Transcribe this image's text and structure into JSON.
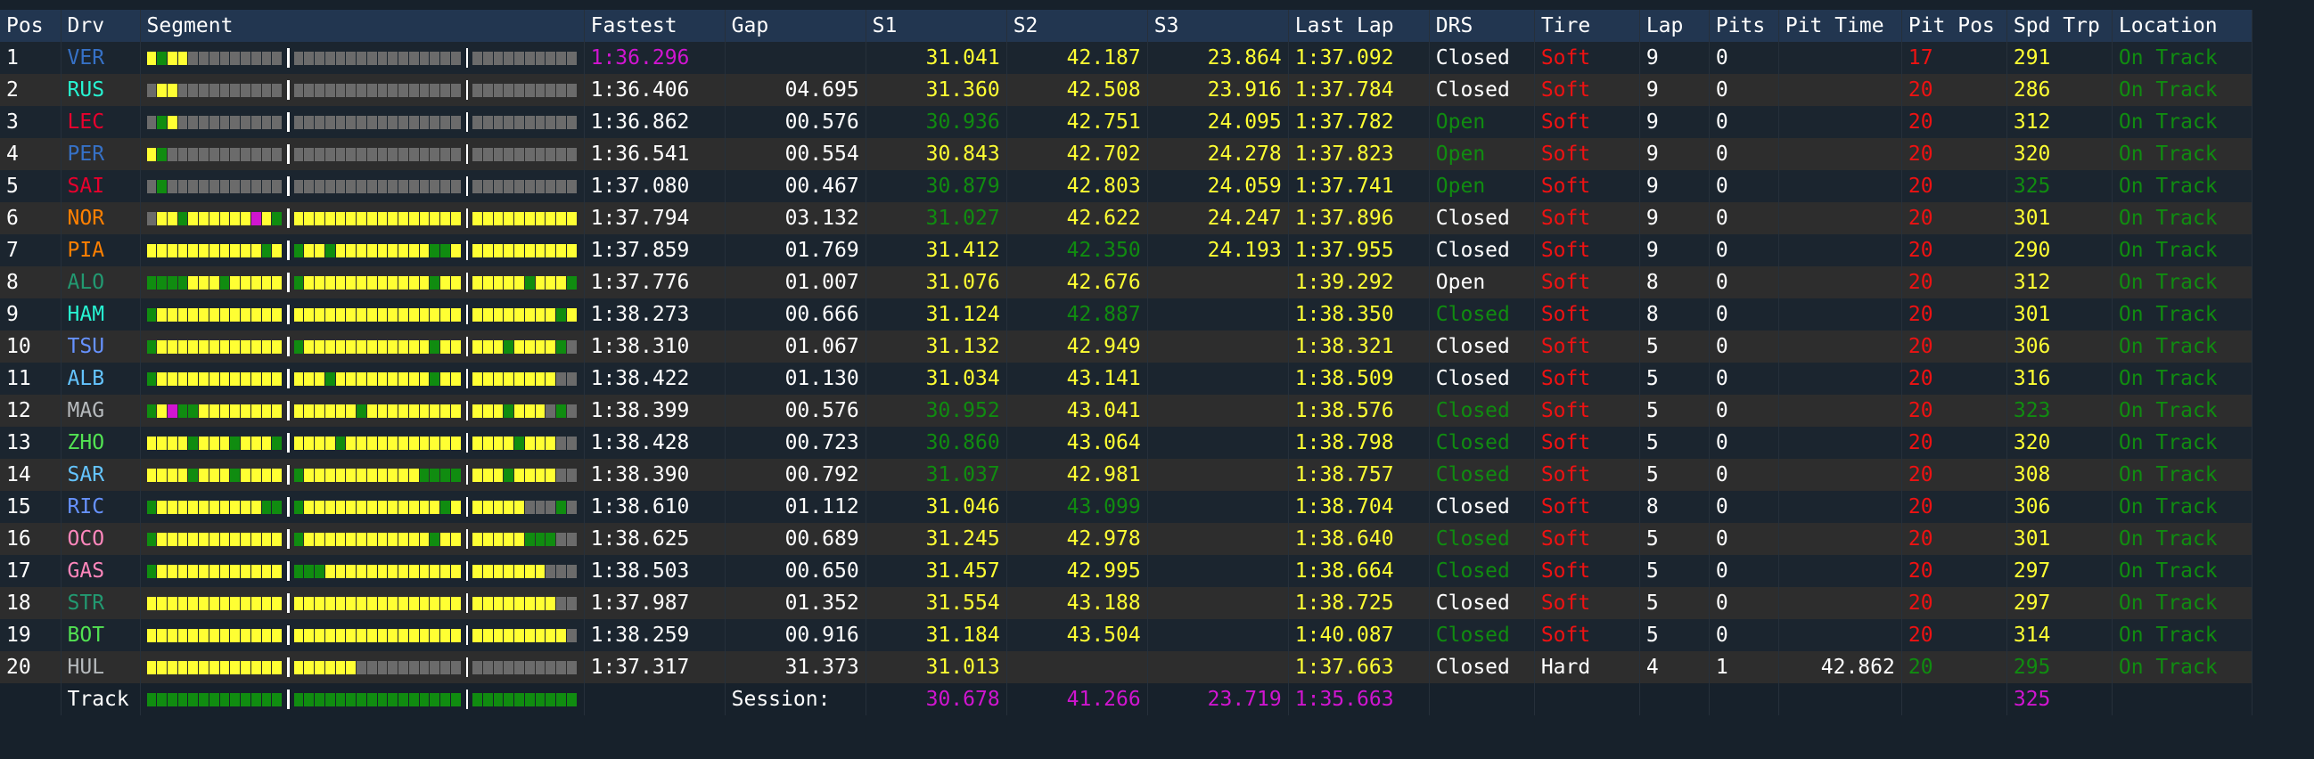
{
  "colors": {
    "white": "#ffffff",
    "yellow": "#ffff33",
    "purple": "#d015d0",
    "green": "#108c10",
    "red": "#ee1212",
    "grey": "#6b6b6b",
    "dimgrey": "#404040",
    "header": "#223650"
  },
  "segment_key": {
    "Y": "yellow",
    "G": "green",
    "P": "purple",
    "g": "grey",
    "d": "dimgrey"
  },
  "header": {
    "pos": "Pos",
    "drv": "Drv",
    "segment": "Segment",
    "fastest": "Fastest",
    "gap": "Gap",
    "s1": "S1",
    "s2": "S2",
    "s3": "S3",
    "last": "Last Lap",
    "drs": "DRS",
    "tire": "Tire",
    "lap": "Lap",
    "pits": "Pits",
    "pit_time": "Pit Time",
    "pit_pos": "Pit Pos",
    "spd": "Spd Trp",
    "location": "Location"
  },
  "rows": [
    {
      "pos": "1",
      "drv": "VER",
      "drv_color": "#3671c6",
      "seg": "YGYYggggggggg|gggggggggggggggg|gggggggggg",
      "fastest": "1:36.296",
      "fastest_c": "purple",
      "gap": "",
      "s1": "31.041",
      "s1_c": "yellow",
      "s2": "42.187",
      "s2_c": "yellow",
      "s3": "23.864",
      "s3_c": "yellow",
      "last": "1:37.092",
      "last_c": "yellow",
      "drs": "Closed",
      "drs_c": "white",
      "tire": "Soft",
      "tire_c": "red",
      "lap": "9",
      "pits": "0",
      "pit_time": "",
      "pit_pos": "17",
      "pit_pos_c": "red",
      "spd": "291",
      "spd_c": "yellow",
      "loc": "On Track"
    },
    {
      "pos": "2",
      "drv": "RUS",
      "drv_color": "#27f4d2",
      "seg": "gYYgggggggggg|gggggggggggggggg|gggggggggg",
      "fastest": "1:36.406",
      "fastest_c": "white",
      "gap": "04.695",
      "s1": "31.360",
      "s1_c": "yellow",
      "s2": "42.508",
      "s2_c": "yellow",
      "s3": "23.916",
      "s3_c": "yellow",
      "last": "1:37.784",
      "last_c": "yellow",
      "drs": "Closed",
      "drs_c": "white",
      "tire": "Soft",
      "tire_c": "red",
      "lap": "9",
      "pits": "0",
      "pit_time": "",
      "pit_pos": "20",
      "pit_pos_c": "red",
      "spd": "286",
      "spd_c": "yellow",
      "loc": "On Track"
    },
    {
      "pos": "3",
      "drv": "LEC",
      "drv_color": "#e8002d",
      "seg": "gGYgggggggggg|gggggggggggggggg|gggggggggg",
      "fastest": "1:36.862",
      "fastest_c": "white",
      "gap": "00.576",
      "s1": "30.936",
      "s1_c": "green",
      "s2": "42.751",
      "s2_c": "yellow",
      "s3": "24.095",
      "s3_c": "yellow",
      "last": "1:37.782",
      "last_c": "yellow",
      "drs": "Open",
      "drs_c": "green",
      "tire": "Soft",
      "tire_c": "red",
      "lap": "9",
      "pits": "0",
      "pit_time": "",
      "pit_pos": "20",
      "pit_pos_c": "red",
      "spd": "312",
      "spd_c": "yellow",
      "loc": "On Track"
    },
    {
      "pos": "4",
      "drv": "PER",
      "drv_color": "#3671c6",
      "seg": "YGggggggggggg|gggggggggggggggg|gggggggggg",
      "fastest": "1:36.541",
      "fastest_c": "white",
      "gap": "00.554",
      "s1": "30.843",
      "s1_c": "yellow",
      "s2": "42.702",
      "s2_c": "yellow",
      "s3": "24.278",
      "s3_c": "yellow",
      "last": "1:37.823",
      "last_c": "yellow",
      "drs": "Open",
      "drs_c": "green",
      "tire": "Soft",
      "tire_c": "red",
      "lap": "9",
      "pits": "0",
      "pit_time": "",
      "pit_pos": "20",
      "pit_pos_c": "red",
      "spd": "320",
      "spd_c": "yellow",
      "loc": "On Track"
    },
    {
      "pos": "5",
      "drv": "SAI",
      "drv_color": "#e8002d",
      "seg": "gGggggggggggg|gggggggggggggggg|gggggggggg",
      "fastest": "1:37.080",
      "fastest_c": "white",
      "gap": "00.467",
      "s1": "30.879",
      "s1_c": "green",
      "s2": "42.803",
      "s2_c": "yellow",
      "s3": "24.059",
      "s3_c": "yellow",
      "last": "1:37.741",
      "last_c": "yellow",
      "drs": "Open",
      "drs_c": "green",
      "tire": "Soft",
      "tire_c": "red",
      "lap": "9",
      "pits": "0",
      "pit_time": "",
      "pit_pos": "20",
      "pit_pos_c": "red",
      "spd": "325",
      "spd_c": "green",
      "loc": "On Track"
    },
    {
      "pos": "6",
      "drv": "NOR",
      "drv_color": "#ff8000",
      "seg": "gYYGYYYYYYPYG|YYYYYYYYYYYYYYYY|YYYYYYYYYY",
      "fastest": "1:37.794",
      "fastest_c": "white",
      "gap": "03.132",
      "s1": "31.027",
      "s1_c": "green",
      "s2": "42.622",
      "s2_c": "yellow",
      "s3": "24.247",
      "s3_c": "yellow",
      "last": "1:37.896",
      "last_c": "yellow",
      "drs": "Closed",
      "drs_c": "white",
      "tire": "Soft",
      "tire_c": "red",
      "lap": "9",
      "pits": "0",
      "pit_time": "",
      "pit_pos": "20",
      "pit_pos_c": "red",
      "spd": "301",
      "spd_c": "yellow",
      "loc": "On Track"
    },
    {
      "pos": "7",
      "drv": "PIA",
      "drv_color": "#ff8000",
      "seg": "YYYYYYYYYYYGY|GYYGYYYYYYYYYGGY|YYYYYYYYYY",
      "fastest": "1:37.859",
      "fastest_c": "white",
      "gap": "01.769",
      "s1": "31.412",
      "s1_c": "yellow",
      "s2": "42.350",
      "s2_c": "green",
      "s3": "24.193",
      "s3_c": "yellow",
      "last": "1:37.955",
      "last_c": "yellow",
      "drs": "Closed",
      "drs_c": "white",
      "tire": "Soft",
      "tire_c": "red",
      "lap": "9",
      "pits": "0",
      "pit_time": "",
      "pit_pos": "20",
      "pit_pos_c": "red",
      "spd": "290",
      "spd_c": "yellow",
      "loc": "On Track"
    },
    {
      "pos": "8",
      "drv": "ALO",
      "drv_color": "#229971",
      "seg": "GGGGYYYGYYYYY|GYYYYYYYYYYYYGYY|YYYYYGYYYG",
      "fastest": "1:37.776",
      "fastest_c": "white",
      "gap": "01.007",
      "s1": "31.076",
      "s1_c": "yellow",
      "s2": "42.676",
      "s2_c": "yellow",
      "s3": "",
      "s3_c": "white",
      "last": "1:39.292",
      "last_c": "yellow",
      "drs": "Open",
      "drs_c": "white",
      "tire": "Soft",
      "tire_c": "red",
      "lap": "8",
      "pits": "0",
      "pit_time": "",
      "pit_pos": "20",
      "pit_pos_c": "red",
      "spd": "312",
      "spd_c": "yellow",
      "loc": "On Track"
    },
    {
      "pos": "9",
      "drv": "HAM",
      "drv_color": "#27f4d2",
      "seg": "GYYYYYYYYYYYY|YYYYYYYYYYYYYYYY|YYYYYYYYGY",
      "fastest": "1:38.273",
      "fastest_c": "white",
      "gap": "00.666",
      "s1": "31.124",
      "s1_c": "yellow",
      "s2": "42.887",
      "s2_c": "green",
      "s3": "",
      "s3_c": "white",
      "last": "1:38.350",
      "last_c": "yellow",
      "drs": "Closed",
      "drs_c": "green",
      "tire": "Soft",
      "tire_c": "red",
      "lap": "8",
      "pits": "0",
      "pit_time": "",
      "pit_pos": "20",
      "pit_pos_c": "red",
      "spd": "301",
      "spd_c": "yellow",
      "loc": "On Track"
    },
    {
      "pos": "10",
      "drv": "TSU",
      "drv_color": "#6692ff",
      "seg": "GYYYYYYYYYYYY|GYYYYYYYYYYYYGYY|YYYGYYYYGg",
      "fastest": "1:38.310",
      "fastest_c": "white",
      "gap": "01.067",
      "s1": "31.132",
      "s1_c": "yellow",
      "s2": "42.949",
      "s2_c": "yellow",
      "s3": "",
      "s3_c": "white",
      "last": "1:38.321",
      "last_c": "yellow",
      "drs": "Closed",
      "drs_c": "white",
      "tire": "Soft",
      "tire_c": "red",
      "lap": "5",
      "pits": "0",
      "pit_time": "",
      "pit_pos": "20",
      "pit_pos_c": "red",
      "spd": "306",
      "spd_c": "yellow",
      "loc": "On Track"
    },
    {
      "pos": "11",
      "drv": "ALB",
      "drv_color": "#64c4ff",
      "seg": "GYYYYYYYYYYYY|YYYGYYYYYYYYYGYY|YYYYYYYYgg",
      "fastest": "1:38.422",
      "fastest_c": "white",
      "gap": "01.130",
      "s1": "31.034",
      "s1_c": "yellow",
      "s2": "43.141",
      "s2_c": "yellow",
      "s3": "",
      "s3_c": "white",
      "last": "1:38.509",
      "last_c": "yellow",
      "drs": "Closed",
      "drs_c": "white",
      "tire": "Soft",
      "tire_c": "red",
      "lap": "5",
      "pits": "0",
      "pit_time": "",
      "pit_pos": "20",
      "pit_pos_c": "red",
      "spd": "316",
      "spd_c": "yellow",
      "loc": "On Track"
    },
    {
      "pos": "12",
      "drv": "MAG",
      "drv_color": "#b6babd",
      "seg": "GYPGGYYYYYYYY|YYYYYYGYYYYYYYYY|YYYGYYYgGg",
      "fastest": "1:38.399",
      "fastest_c": "white",
      "gap": "00.576",
      "s1": "30.952",
      "s1_c": "green",
      "s2": "43.041",
      "s2_c": "yellow",
      "s3": "",
      "s3_c": "white",
      "last": "1:38.576",
      "last_c": "yellow",
      "drs": "Closed",
      "drs_c": "green",
      "tire": "Soft",
      "tire_c": "red",
      "lap": "5",
      "pits": "0",
      "pit_time": "",
      "pit_pos": "20",
      "pit_pos_c": "red",
      "spd": "323",
      "spd_c": "green",
      "loc": "On Track"
    },
    {
      "pos": "13",
      "drv": "ZHO",
      "drv_color": "#52e252",
      "seg": "YYYYGYYYGYYYG|YYYYGYYYYYYYYYYY|YYYYGYYYgg",
      "fastest": "1:38.428",
      "fastest_c": "white",
      "gap": "00.723",
      "s1": "30.860",
      "s1_c": "green",
      "s2": "43.064",
      "s2_c": "yellow",
      "s3": "",
      "s3_c": "white",
      "last": "1:38.798",
      "last_c": "yellow",
      "drs": "Closed",
      "drs_c": "green",
      "tire": "Soft",
      "tire_c": "red",
      "lap": "5",
      "pits": "0",
      "pit_time": "",
      "pit_pos": "20",
      "pit_pos_c": "red",
      "spd": "320",
      "spd_c": "yellow",
      "loc": "On Track"
    },
    {
      "pos": "14",
      "drv": "SAR",
      "drv_color": "#64c4ff",
      "seg": "YYYYGYYYGYYYY|GYYYYYYYYYYYGGGG|YYYGYYYYgg",
      "fastest": "1:38.390",
      "fastest_c": "white",
      "gap": "00.792",
      "s1": "31.037",
      "s1_c": "green",
      "s2": "42.981",
      "s2_c": "yellow",
      "s3": "",
      "s3_c": "white",
      "last": "1:38.757",
      "last_c": "yellow",
      "drs": "Closed",
      "drs_c": "green",
      "tire": "Soft",
      "tire_c": "red",
      "lap": "5",
      "pits": "0",
      "pit_time": "",
      "pit_pos": "20",
      "pit_pos_c": "red",
      "spd": "308",
      "spd_c": "yellow",
      "loc": "On Track"
    },
    {
      "pos": "15",
      "drv": "RIC",
      "drv_color": "#6692ff",
      "seg": "GYYYYYYYYYYGG|GYYYYYYYYYYYYYGY|YYYYYgggGg",
      "fastest": "1:38.610",
      "fastest_c": "white",
      "gap": "01.112",
      "s1": "31.046",
      "s1_c": "yellow",
      "s2": "43.099",
      "s2_c": "green",
      "s3": "",
      "s3_c": "white",
      "last": "1:38.704",
      "last_c": "yellow",
      "drs": "Closed",
      "drs_c": "white",
      "tire": "Soft",
      "tire_c": "red",
      "lap": "8",
      "pits": "0",
      "pit_time": "",
      "pit_pos": "20",
      "pit_pos_c": "red",
      "spd": "306",
      "spd_c": "yellow",
      "loc": "On Track"
    },
    {
      "pos": "16",
      "drv": "OCO",
      "drv_color": "#ff87bc",
      "seg": "GYYYYYYYYYYYY|GYYYYYYYYYYYYGYY|YYYYYGGGgg",
      "fastest": "1:38.625",
      "fastest_c": "white",
      "gap": "00.689",
      "s1": "31.245",
      "s1_c": "yellow",
      "s2": "42.978",
      "s2_c": "yellow",
      "s3": "",
      "s3_c": "white",
      "last": "1:38.640",
      "last_c": "yellow",
      "drs": "Closed",
      "drs_c": "green",
      "tire": "Soft",
      "tire_c": "red",
      "lap": "5",
      "pits": "0",
      "pit_time": "",
      "pit_pos": "20",
      "pit_pos_c": "red",
      "spd": "301",
      "spd_c": "yellow",
      "loc": "On Track"
    },
    {
      "pos": "17",
      "drv": "GAS",
      "drv_color": "#ff87bc",
      "seg": "GYYYYYYYYYYYY|GGGYYYYYYYYYYYYY|YYYYYYYggg",
      "fastest": "1:38.503",
      "fastest_c": "white",
      "gap": "00.650",
      "s1": "31.457",
      "s1_c": "yellow",
      "s2": "42.995",
      "s2_c": "yellow",
      "s3": "",
      "s3_c": "white",
      "last": "1:38.664",
      "last_c": "yellow",
      "drs": "Closed",
      "drs_c": "green",
      "tire": "Soft",
      "tire_c": "red",
      "lap": "5",
      "pits": "0",
      "pit_time": "",
      "pit_pos": "20",
      "pit_pos_c": "red",
      "spd": "297",
      "spd_c": "yellow",
      "loc": "On Track"
    },
    {
      "pos": "18",
      "drv": "STR",
      "drv_color": "#229971",
      "seg": "YYYYYYYYYYYYY|YYYYYYYYYYYYYYYY|YYYYYYYYgg",
      "fastest": "1:37.987",
      "fastest_c": "white",
      "gap": "01.352",
      "s1": "31.554",
      "s1_c": "yellow",
      "s2": "43.188",
      "s2_c": "yellow",
      "s3": "",
      "s3_c": "white",
      "last": "1:38.725",
      "last_c": "yellow",
      "drs": "Closed",
      "drs_c": "white",
      "tire": "Soft",
      "tire_c": "red",
      "lap": "5",
      "pits": "0",
      "pit_time": "",
      "pit_pos": "20",
      "pit_pos_c": "red",
      "spd": "297",
      "spd_c": "yellow",
      "loc": "On Track"
    },
    {
      "pos": "19",
      "drv": "BOT",
      "drv_color": "#52e252",
      "seg": "YYYYYYYYYYYYY|YYYYYYYYYYYYYYYY|YYYYYYYYYg",
      "fastest": "1:38.259",
      "fastest_c": "white",
      "gap": "00.916",
      "s1": "31.184",
      "s1_c": "yellow",
      "s2": "43.504",
      "s2_c": "yellow",
      "s3": "",
      "s3_c": "white",
      "last": "1:40.087",
      "last_c": "yellow",
      "drs": "Closed",
      "drs_c": "green",
      "tire": "Soft",
      "tire_c": "red",
      "lap": "5",
      "pits": "0",
      "pit_time": "",
      "pit_pos": "20",
      "pit_pos_c": "red",
      "spd": "314",
      "spd_c": "yellow",
      "loc": "On Track"
    },
    {
      "pos": "20",
      "drv": "HUL",
      "drv_color": "#b6babd",
      "seg": "YYYYYYYYYYYYY|YYYYYYgggggggggg|gggggggggg",
      "fastest": "1:37.317",
      "fastest_c": "white",
      "gap": "31.373",
      "s1": "31.013",
      "s1_c": "yellow",
      "s2": "",
      "s2_c": "white",
      "s3": "",
      "s3_c": "white",
      "last": "1:37.663",
      "last_c": "yellow",
      "drs": "Closed",
      "drs_c": "white",
      "tire": "Hard",
      "tire_c": "white",
      "lap": "4",
      "pits": "1",
      "pit_time": "42.862",
      "pit_pos": "20",
      "pit_pos_c": "green",
      "spd": "295",
      "spd_c": "green",
      "loc": "On Track"
    }
  ],
  "track": {
    "label": "Track",
    "seg": "GGGGGGGGGGGGG|GGGGGGGGGGGGGGGG|GGGGGGGGGG",
    "session_label": "Session:",
    "s1": "30.678",
    "s2": "41.266",
    "s3": "23.719",
    "last": "1:35.663",
    "spd": "325"
  }
}
